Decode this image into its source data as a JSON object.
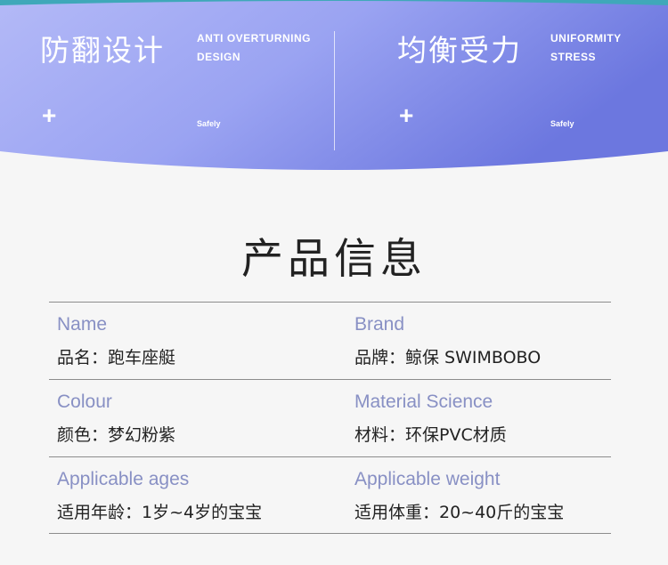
{
  "banner": {
    "colors": {
      "gradient_start": "#b0b6f6",
      "gradient_end": "#6d79e0"
    },
    "features": [
      {
        "title_cn": "防翻设计",
        "title_en": "ANTI OVERTURNING\nDESIGN",
        "plus": "+",
        "small": "Safely"
      },
      {
        "title_cn": "均衡受力",
        "title_en": "UNIFORMITY\nSTRESS",
        "plus": "+",
        "small": "Safely"
      }
    ]
  },
  "section": {
    "title": "产品信息"
  },
  "info_table": {
    "rows": [
      [
        {
          "label": "Name",
          "value": "品名：跑车座艇"
        },
        {
          "label": "Brand",
          "value": "品牌：鲸保 SWIMBOBO"
        }
      ],
      [
        {
          "label": "Colour",
          "value": "颜色：梦幻粉紫"
        },
        {
          "label": "Material Science",
          "value": "材料：环保PVC材质"
        }
      ],
      [
        {
          "label": "Applicable ages",
          "value": "适用年龄：1岁~4岁的宝宝"
        },
        {
          "label": "Applicable weight",
          "value": "适用体重：20~40斤的宝宝"
        }
      ]
    ]
  }
}
